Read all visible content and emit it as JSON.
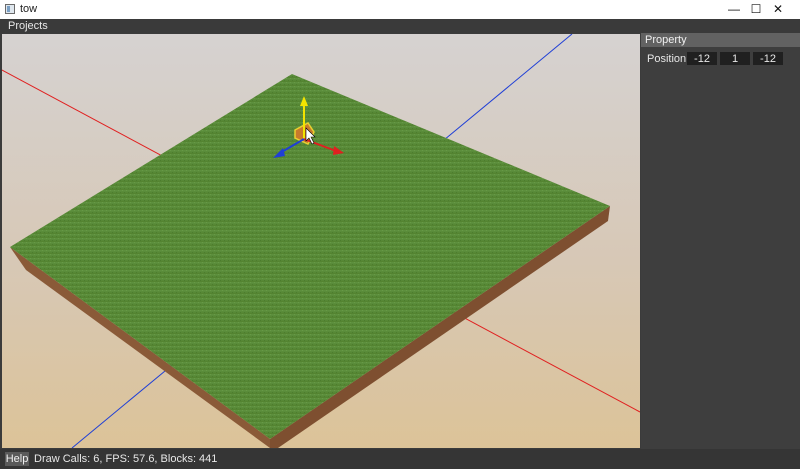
{
  "window": {
    "title": "tow",
    "minimize_glyph": "—",
    "maximize_glyph": "☐",
    "close_glyph": "✕"
  },
  "menu": {
    "projects_label": "Projects"
  },
  "property_panel": {
    "header": "Property",
    "position_label": "Position",
    "position": {
      "x": "-12",
      "y": "1",
      "z": "-12"
    }
  },
  "status": {
    "help_label": "Help",
    "text": "Draw Calls: 6, FPS: 57.6, Blocks: 441"
  },
  "colors": {
    "grass": "#5a8d3a",
    "dirt": "#8a5a38",
    "axis_x": "#e02020",
    "axis_y": "#f2e400",
    "axis_z": "#1f3fd6"
  }
}
